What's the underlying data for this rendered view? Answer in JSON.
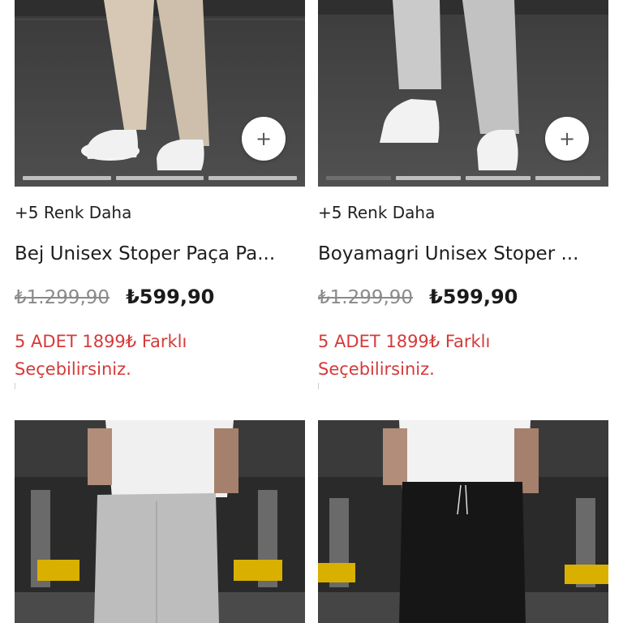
{
  "products": [
    {
      "more_colors": "+5 Renk Daha",
      "name": "Bej Unisex Stoper Paça Pa...",
      "old_price": "₺1.299,90",
      "price": "₺599,90",
      "promo": "5 ADET 1899₺ Farklı Seçebilirsiniz.",
      "add_icon": "plus-icon",
      "pants_color": "#d6c8b4"
    },
    {
      "more_colors": "+5 Renk Daha",
      "name": "Boyamagri Unisex Stoper ...",
      "old_price": "₺1.299,90",
      "price": "₺599,90",
      "promo": "5 ADET 1899₺ Farklı Seçebilirsiniz.",
      "add_icon": "plus-icon",
      "pants_color": "#c8c8c8"
    },
    {
      "pants_color": "#bdbdbd"
    },
    {
      "pants_color": "#161616"
    }
  ],
  "add_symbol": "+"
}
